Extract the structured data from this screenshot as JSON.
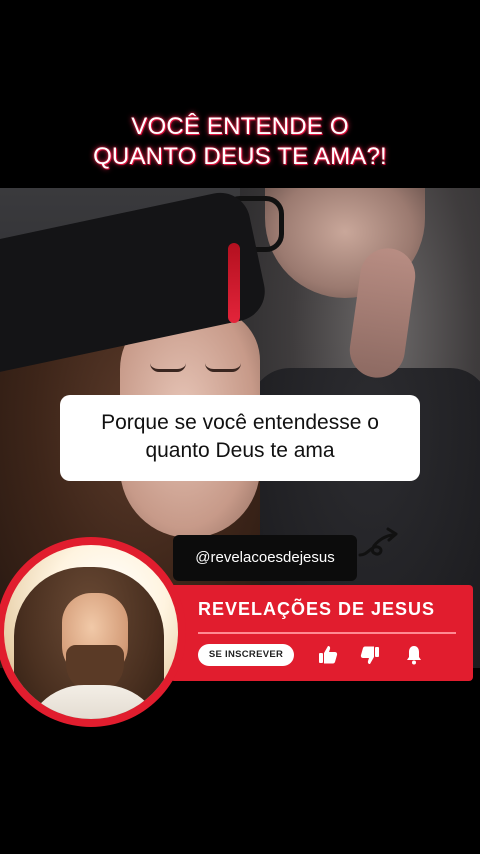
{
  "headline": {
    "line1": "VOCÊ ENTENDE O",
    "line2": "QUANTO DEUS TE AMA?!"
  },
  "caption": {
    "line1": "Porque se você entendesse o",
    "line2": "quanto Deus te ama"
  },
  "handle": "@revelacoesdejesus",
  "banner": {
    "channel_name": "REVELAÇÕES DE JESUS",
    "subscribe_label": "SE INSCREVER",
    "icons": [
      "thumbs-up-icon",
      "thumbs-down-icon",
      "bell-icon"
    ]
  },
  "colors": {
    "accent": "#e11d2e",
    "headline_glow": "#ff2a55"
  }
}
